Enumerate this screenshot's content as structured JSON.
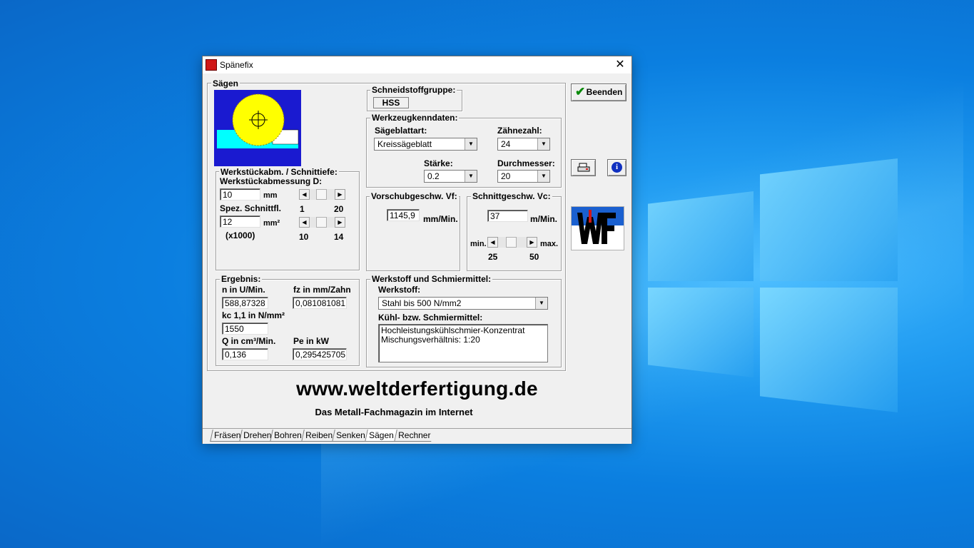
{
  "window": {
    "title": "Spänefix",
    "close_glyph": "✕"
  },
  "saegen": {
    "group_label": "Sägen"
  },
  "schneidstoff": {
    "label": "Schneidstoffgruppe:",
    "value": "HSS"
  },
  "werkzeug": {
    "label": "Werkzeugkenndaten:",
    "saegeblattart_label": "Sägeblattart:",
    "saegeblattart_value": "Kreissägeblatt",
    "zaehnezahl_label": "Zähnezahl:",
    "zaehnezahl_value": "24",
    "staerke_label": "Stärke:",
    "staerke_value": "0.2",
    "durchmesser_label": "Durchmesser:",
    "durchmesser_value": "20"
  },
  "werkstueck": {
    "label": "Werkstückabm. / Schnittiefe:",
    "abmessung_label": "Werkstückabmessung D:",
    "abmessung_value": "10",
    "abmessung_unit": "mm",
    "abmessung_min": "1",
    "abmessung_max": "20",
    "schnittfl_label": "Spez. Schnittfl.",
    "schnittfl_value": "12",
    "schnittfl_unit": "mm²",
    "schnittfl_factor": "(x1000)",
    "schnittfl_min": "10",
    "schnittfl_max": "14"
  },
  "vorschub": {
    "label": "Vorschubgeschw. Vf:",
    "value": "1145,9",
    "unit": "mm/Min."
  },
  "schnittgeschw": {
    "label": "Schnittgeschw. Vc:",
    "value": "37",
    "unit": "m/Min.",
    "min_label": "min.",
    "max_label": "max.",
    "min_value": "25",
    "max_value": "50"
  },
  "ergebnis": {
    "label": "Ergebnis:",
    "n_label": "n in U/Min.",
    "n_value": "588,87328",
    "fz_label": "fz in mm/Zahn",
    "fz_value": "0,081081081",
    "kc_label": "kc 1,1 in N/mm²",
    "kc_value": "1550",
    "q_label": "Q in cm³/Min.",
    "q_value": "0,136",
    "pe_label": "Pe in kW",
    "pe_value": "0,295425705"
  },
  "werkstoff": {
    "label": "Werkstoff und Schmiermittel:",
    "werkstoff_label": "Werkstoff:",
    "werkstoff_value": "Stahl bis 500 N/mm2",
    "kuehl_label": "Kühl- bzw. Schmiermittel:",
    "kuehl_line1": "Hochleistungskühlschmier-Konzentrat",
    "kuehl_line2": "Mischungsverhältnis: 1:20"
  },
  "buttons": {
    "beenden": "Beenden"
  },
  "brand": {
    "url": "www.weltderfertigung.de",
    "tagline": "Das Metall-Fachmagazin im Internet"
  },
  "tabs": [
    "Fräsen",
    "Drehen",
    "Bohren",
    "Reiben",
    "Senken",
    "Sägen",
    "Rechner"
  ],
  "active_tab": "Sägen",
  "colors": {
    "accent_blue": "#1a1ad0",
    "saw_yellow": "#ffff00",
    "workpiece_cyan": "#00ffff"
  }
}
